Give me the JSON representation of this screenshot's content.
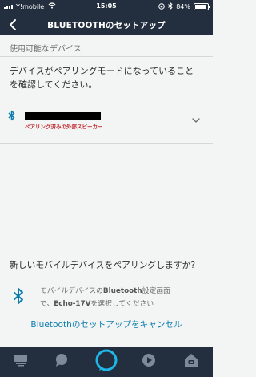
{
  "status_bar": {
    "carrier": "Y!mobile",
    "time": "15:05",
    "battery_percent": "84%",
    "battery_level": 0.84
  },
  "header": {
    "title": "BLUETOOTHのセットアップ"
  },
  "section": {
    "label": "使用可能なデバイス"
  },
  "instruction": {
    "line1": "デバイスがペアリングモードになっていること",
    "line2": "を確認してください。"
  },
  "device": {
    "name": "",
    "subtitle": "ペアリング済みの外部スピーカー"
  },
  "pairing": {
    "question": "新しいモバイルデバイスをペアリングしますか?",
    "hint_line1_prefix": "モバイルデバイスの",
    "hint_line1_bold": "Bluetooth",
    "hint_line1_suffix": "設定画面",
    "hint_line2_prefix": "で、",
    "hint_line2_bold": "Echo-17V",
    "hint_line2_suffix": "を選択してください"
  },
  "cancel": {
    "label": "Bluetoothのセットアップをキャンセル"
  },
  "bottom_nav": {
    "tabs": [
      "home-icon",
      "chat-icon",
      "alexa-icon",
      "play-icon",
      "devices-icon"
    ]
  },
  "colors": {
    "header_bg": "#232f3e",
    "accent_blue": "#0b7dad",
    "alexa_cyan": "#1fb6e8",
    "device_subtitle": "#c0272d"
  }
}
